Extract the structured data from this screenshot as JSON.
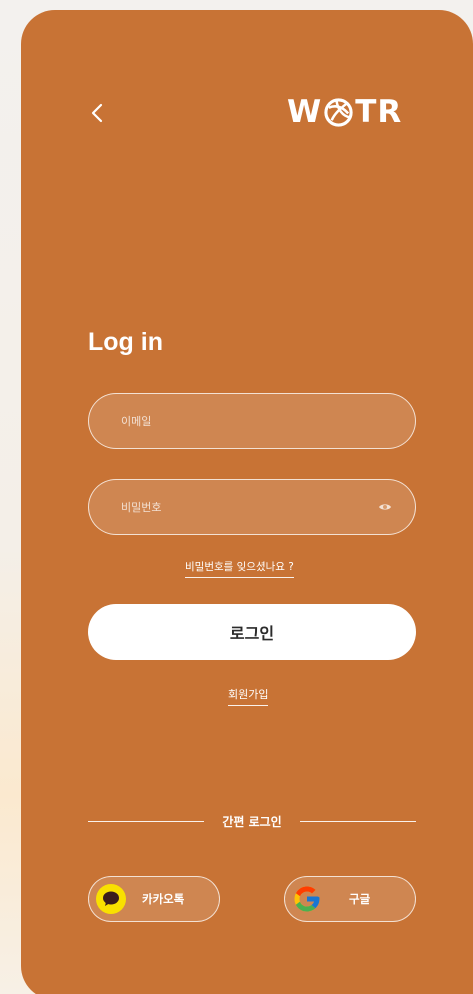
{
  "header": {
    "back_icon": "chevron-left-icon",
    "logo_text": "WOTR"
  },
  "login": {
    "title": "Log in",
    "email_placeholder": "이메일",
    "password_placeholder": "비밀번호",
    "password_toggle_icon": "eye-icon",
    "forgot_password": "비밀번호를 잊으셨나요 ?",
    "submit_label": "로그인",
    "signup_label": "회원가입"
  },
  "social": {
    "divider_label": "간편 로그인",
    "kakao": {
      "label": "카카오톡",
      "icon": "kakao-talk-icon"
    },
    "google": {
      "label": "구글",
      "icon": "google-icon"
    }
  },
  "colors": {
    "card_background": "#c87335",
    "button_background": "#ffffff",
    "kakao_yellow": "#f9e000"
  }
}
